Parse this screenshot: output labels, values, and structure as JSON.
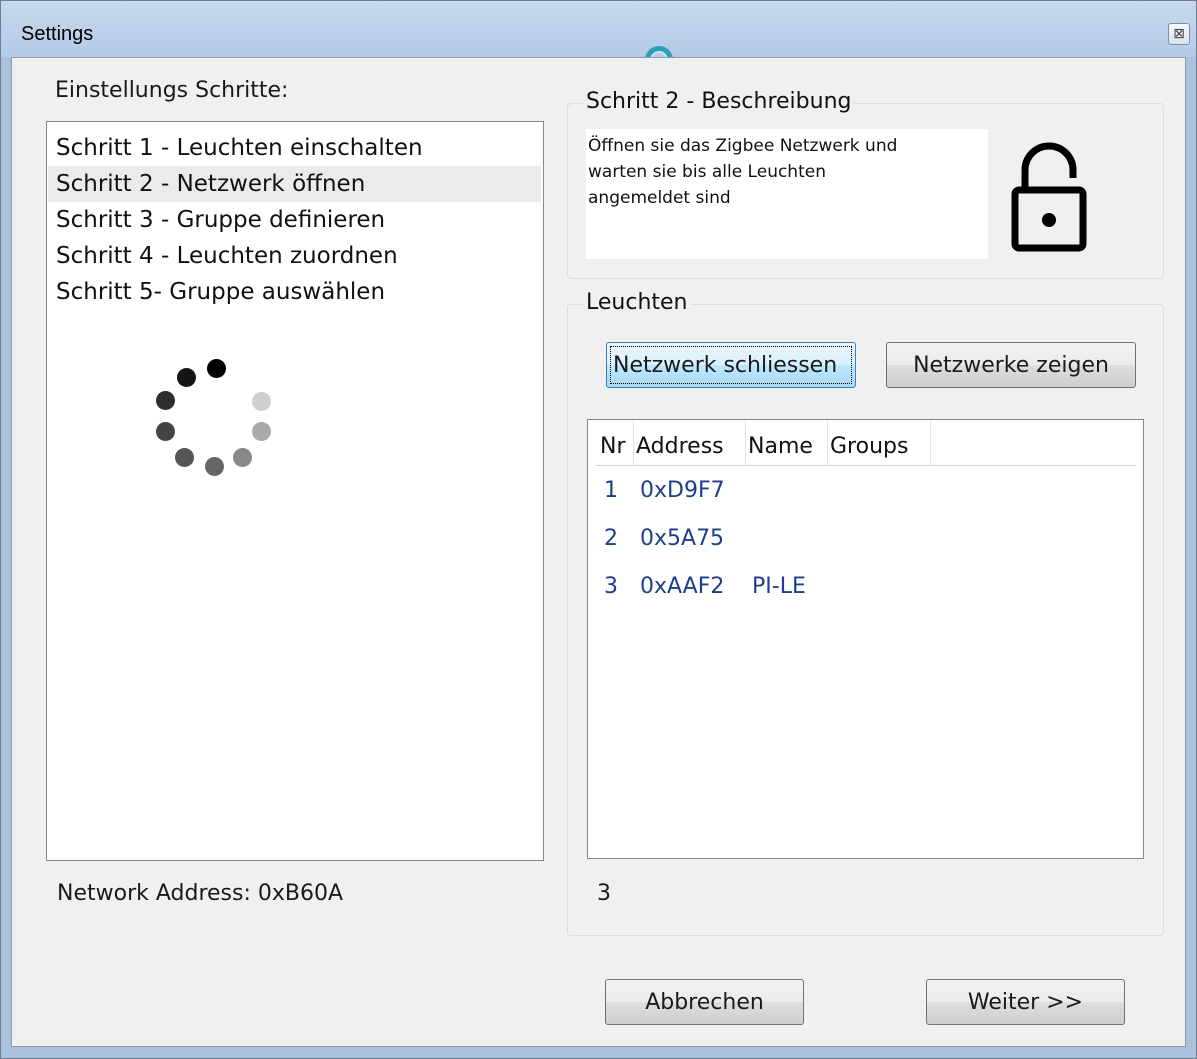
{
  "window": {
    "title": "Settings",
    "close_glyph": "⊠"
  },
  "steps": {
    "heading": "Einstellungs Schritte:",
    "selected_index": 1,
    "items": [
      {
        "label": "Schritt 1 - Leuchten einschalten"
      },
      {
        "label": "Schritt 2 - Netzwerk öffnen"
      },
      {
        "label": "Schritt 3 - Gruppe definieren"
      },
      {
        "label": "Schritt 4 - Leuchten zuordnen"
      },
      {
        "label": "Schritt 5- Gruppe auswählen"
      }
    ],
    "network_address": "Network Address: 0xB60A"
  },
  "description": {
    "group_title": "Schritt 2 - Beschreibung",
    "text_line1": "Öffnen sie das Zigbee Netzwerk und",
    "text_line2": "warten sie bis alle Leuchten",
    "text_line3": "angemeldet sind",
    "icon": "lock-open-icon"
  },
  "lights": {
    "group_title": "Leuchten",
    "close_network_button": "Netzwerk schliessen",
    "show_networks_button": "Netzwerke zeigen",
    "columns": [
      "Nr",
      "Address",
      "Name",
      "Groups"
    ],
    "rows": [
      {
        "nr": "1",
        "address": "0xD9F7",
        "name": "",
        "groups": ""
      },
      {
        "nr": "2",
        "address": "0x5A75",
        "name": "",
        "groups": ""
      },
      {
        "nr": "3",
        "address": "0xAAF2",
        "name": "PI-LE",
        "groups": ""
      }
    ],
    "count": "3"
  },
  "footer": {
    "cancel_button": "Abbrechen",
    "next_button": "Weiter >>"
  },
  "colors": {
    "titlebar": "#b9cfe8",
    "list_text": "#1d3e8a",
    "focused_button_border": "#3c7fb1"
  }
}
